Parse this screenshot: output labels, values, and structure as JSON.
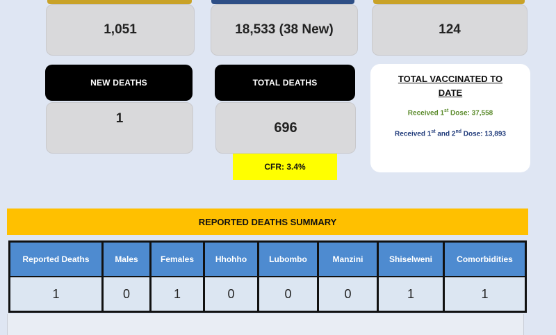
{
  "top_stats": [
    {
      "value": "1,051",
      "accent": "#c9a227"
    },
    {
      "value": "18,533 (38 New)",
      "accent": "#2e4f86"
    },
    {
      "value": "124",
      "accent": "#c9a227"
    }
  ],
  "new_deaths": {
    "label": "NEW DEATHS",
    "value": "1"
  },
  "total_deaths": {
    "label": "TOTAL DEATHS",
    "value": "696"
  },
  "cfr": "CFR: 3.4%",
  "vaccinated": {
    "title_line1": "TOTAL VACCINATED TO",
    "title_line2": "DATE",
    "first_dose_prefix": "Received 1",
    "first_dose_sup": "st",
    "first_dose_suffix": " Dose: 37,558",
    "both_dose_prefix": "Received 1",
    "both_dose_sup1": "st",
    "both_dose_mid": " and 2",
    "both_dose_sup2": "nd",
    "both_dose_suffix": " Dose: 13,893"
  },
  "deaths_summary": {
    "title": "REPORTED DEATHS SUMMARY",
    "columns": [
      {
        "header": "Reported Deaths",
        "value": "1"
      },
      {
        "header": "Males",
        "value": "0"
      },
      {
        "header": "Females",
        "value": "1"
      },
      {
        "header": "Hhohho",
        "value": "0"
      },
      {
        "header": "Lubombo",
        "value": "0"
      },
      {
        "header": "Manzini",
        "value": "0"
      },
      {
        "header": "Shiselweni",
        "value": "1"
      },
      {
        "header": "Comorbidities",
        "value": "1"
      }
    ]
  },
  "colors": {
    "header_blue": "#4e8bd0",
    "summary_yellow": "#ffc000",
    "cfr_yellow": "#ffff00",
    "green_text": "#5a8a2a",
    "blue_text": "#1f3a7a"
  }
}
